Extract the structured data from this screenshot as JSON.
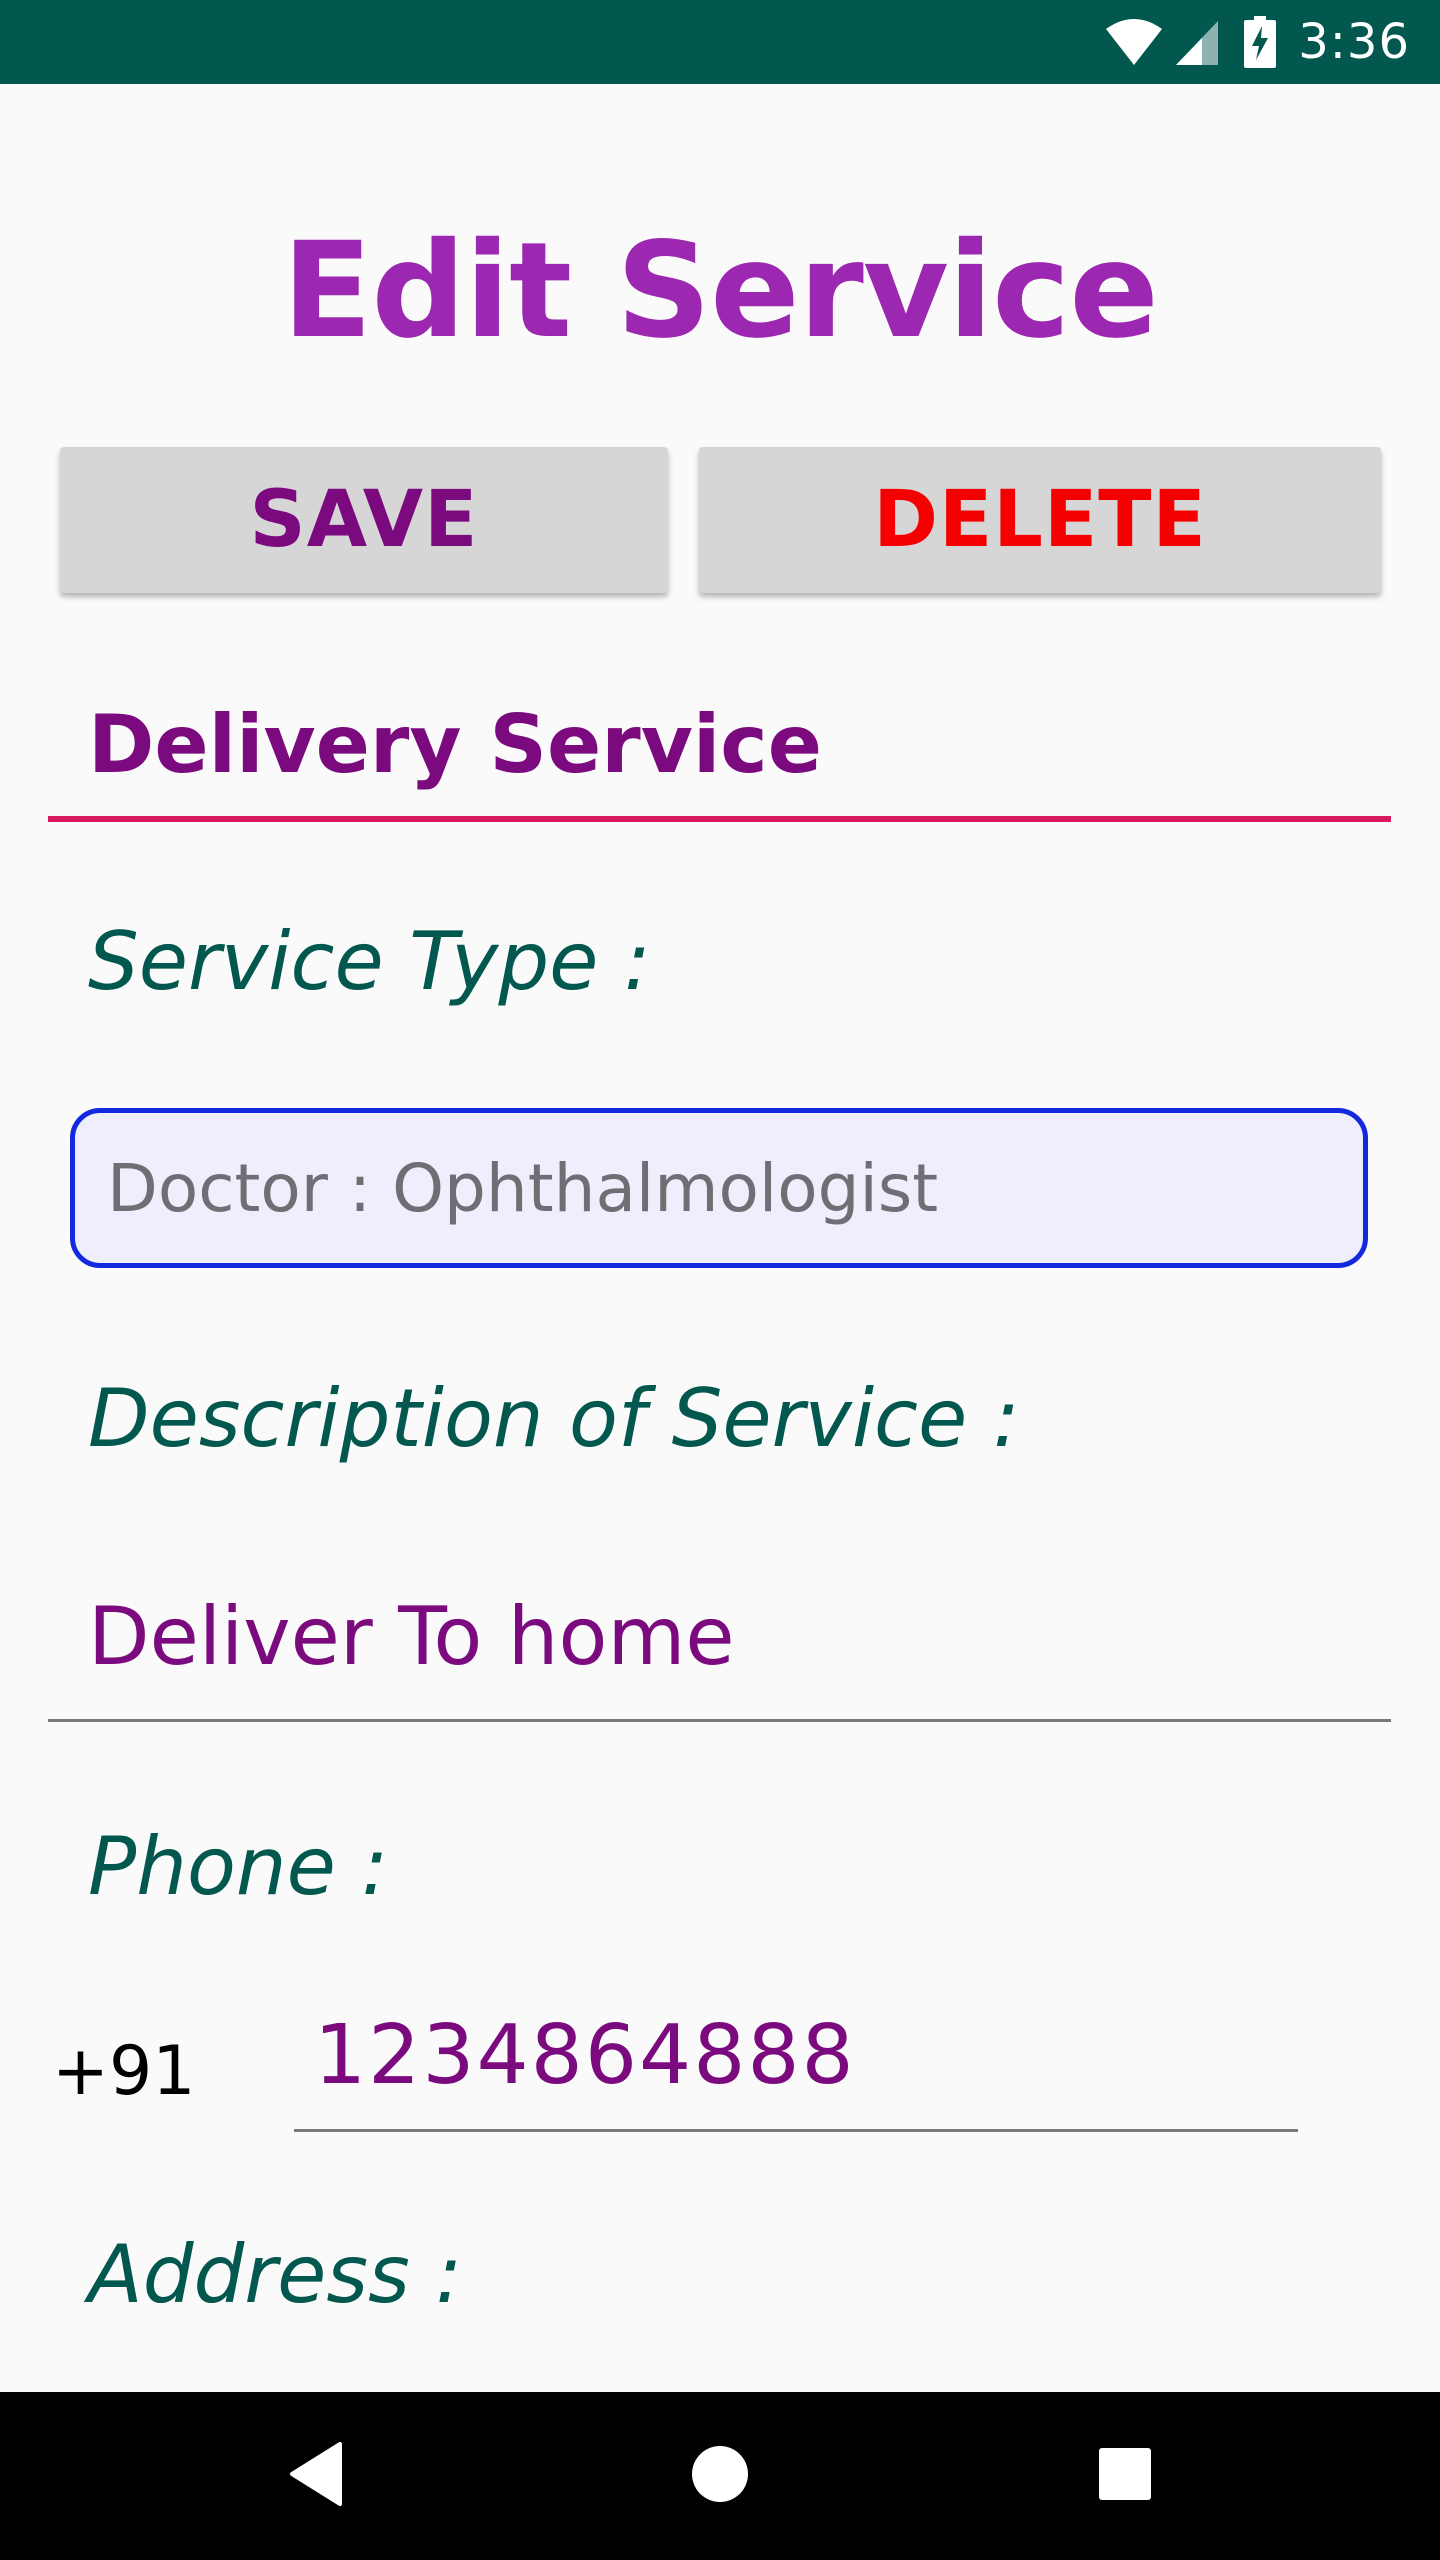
{
  "status_bar": {
    "time": "3:36",
    "icons": [
      "wifi-icon",
      "cellular-signal-icon",
      "battery-charging-icon"
    ]
  },
  "page": {
    "title": "Edit Service"
  },
  "actions": {
    "save_label": "SAVE",
    "delete_label": "DELETE"
  },
  "form": {
    "service_name": "Delivery Service",
    "service_type_label": "Service Type :",
    "service_type_value": "Doctor : Ophthalmologist",
    "description_label": "Description of Service :",
    "description_value": "Deliver To home",
    "phone_label": "Phone :",
    "phone_prefix": "+91",
    "phone_value": "1234864888",
    "address_label": "Address :"
  },
  "nav_bar": {
    "icons": [
      "back-icon",
      "home-icon",
      "recents-icon"
    ]
  },
  "colors": {
    "status_bar": "#02574e",
    "title": "#9c27b0",
    "save_text": "#7b0a7f",
    "delete_text": "#f50000",
    "label_text": "#02574e",
    "field_text": "#7b0a7f",
    "active_underline": "#d81b60",
    "type_box_border": "#1428e0"
  }
}
